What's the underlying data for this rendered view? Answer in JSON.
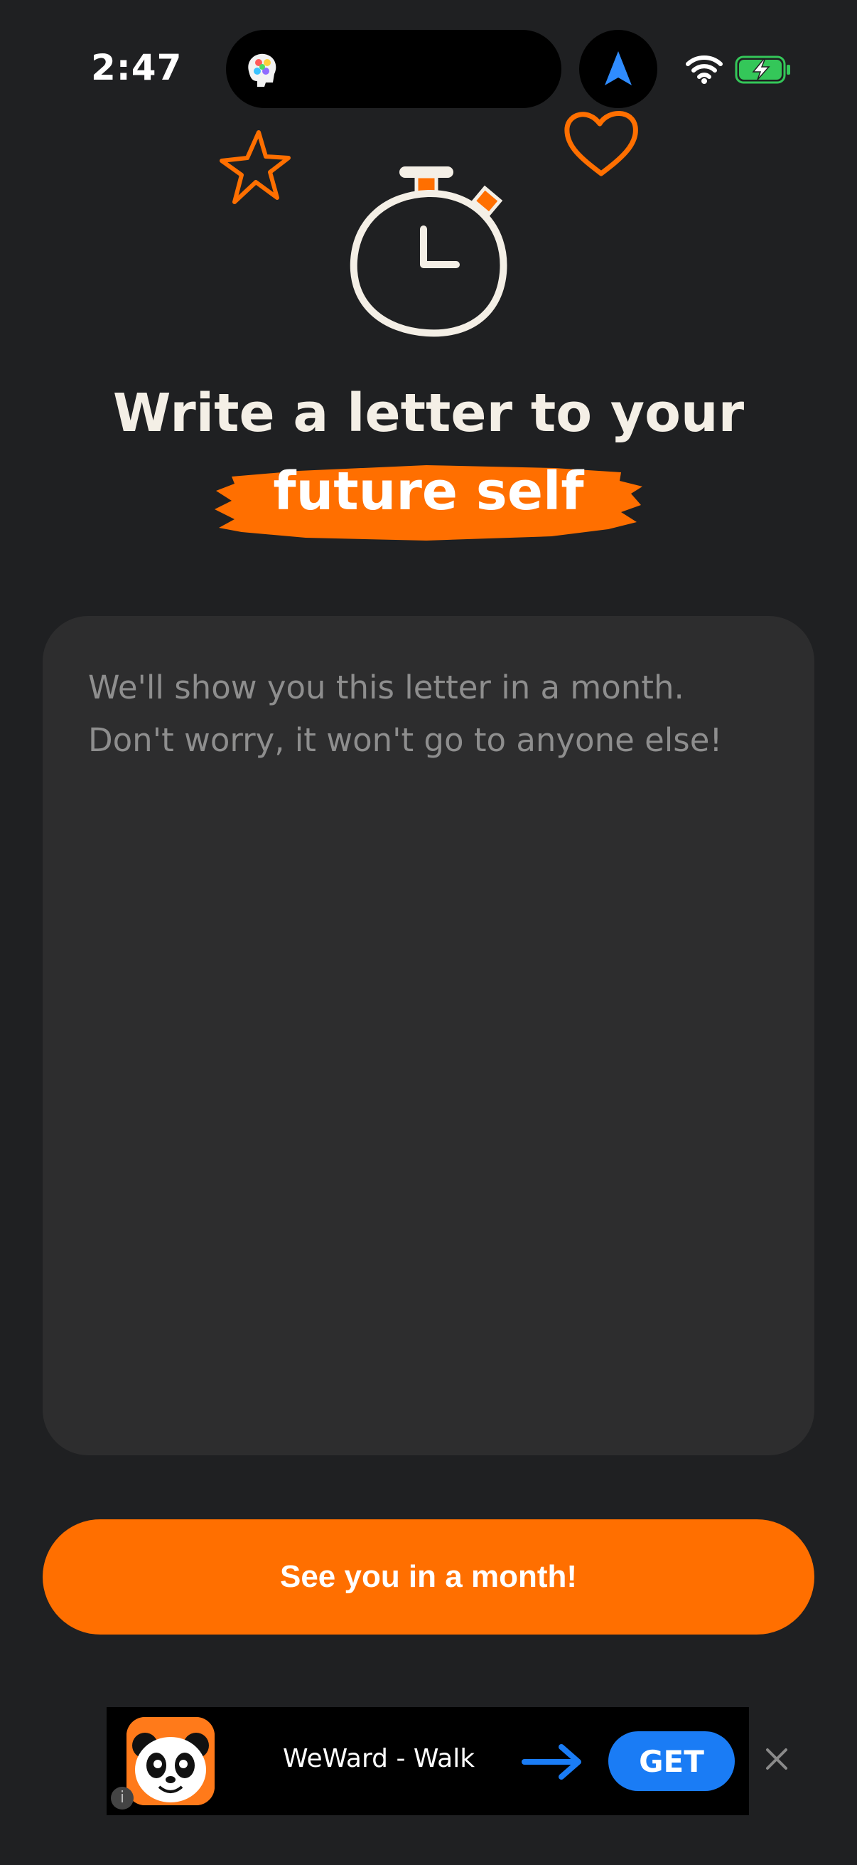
{
  "status_bar": {
    "time": "2:47",
    "island_app_icon": "brain-app-icon",
    "navigation_icon": "location-arrow-icon",
    "wifi_icon": "wifi-icon",
    "battery_icon": "battery-charging-icon",
    "battery_color": "#34c759"
  },
  "illustration": {
    "decorations": [
      "star-icon",
      "heart-icon"
    ],
    "main_icon": "stopwatch-icon"
  },
  "header": {
    "title_line1": "Write a letter to your",
    "title_highlight": "future self"
  },
  "letter": {
    "value": "",
    "placeholder": "We'll show you this letter in a month.\nDon't worry, it won't go to anyone else!"
  },
  "cta": {
    "label": "See you in a month!"
  },
  "ad": {
    "app_name": "WeWard - Walk",
    "icon": "panda-app-icon",
    "info_label": "i",
    "get_label": "GET",
    "close_icon": "close-icon"
  },
  "colors": {
    "background": "#1f2022",
    "accent": "#ff6f00",
    "card": "#2d2d2e",
    "ad_button": "#1a7cf5"
  }
}
